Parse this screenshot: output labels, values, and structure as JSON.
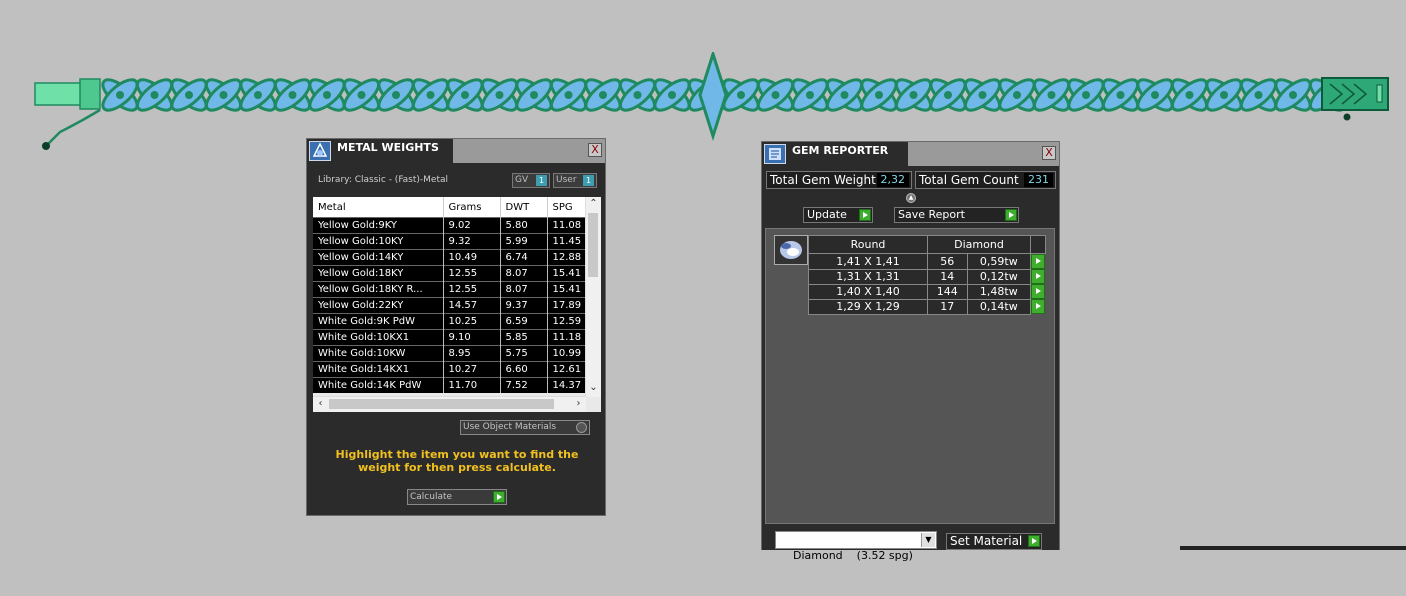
{
  "colors": {
    "viewport_bg": "#c0c0c0",
    "panel_bg": "#2b2b2b",
    "hint_text": "#f0c020",
    "go_green": "#3fae2f",
    "gem_teal": "#1f8a60",
    "gem_blue": "#6fb8e8"
  },
  "metal_weights": {
    "title": "METAL WEIGHTS",
    "close_label": "X",
    "library": "Library: Classic - (Fast)-Metal",
    "toggle_gv": "GV",
    "toggle_user": "User",
    "toggle_value": "1",
    "columns": [
      "Metal",
      "Grams",
      "DWT",
      "SPG"
    ],
    "rows": [
      [
        "Yellow Gold:9KY",
        "9.02",
        "5.80",
        "11.08"
      ],
      [
        "Yellow Gold:10KY",
        "9.32",
        "5.99",
        "11.45"
      ],
      [
        "Yellow Gold:14KY",
        "10.49",
        "6.74",
        "12.88"
      ],
      [
        "Yellow Gold:18KY",
        "12.55",
        "8.07",
        "15.41"
      ],
      [
        "Yellow Gold:18KY R...",
        "12.55",
        "8.07",
        "15.41"
      ],
      [
        "Yellow Gold:22KY",
        "14.57",
        "9.37",
        "17.89"
      ],
      [
        "White Gold:9K PdW",
        "10.25",
        "6.59",
        "12.59"
      ],
      [
        "White Gold:10KX1",
        "9.10",
        "5.85",
        "11.18"
      ],
      [
        "White Gold:10KW",
        "8.95",
        "5.75",
        "10.99"
      ],
      [
        "White Gold:14KX1",
        "10.27",
        "6.60",
        "12.61"
      ],
      [
        "White Gold:14K PdW",
        "11.70",
        "7.52",
        "14.37"
      ]
    ],
    "use_object_materials": "Use Object Materials",
    "hint": "Highlight the item you want to find the weight for then press calculate.",
    "calculate_label": "Calculate"
  },
  "gem_reporter": {
    "title": "GEM REPORTER",
    "close_label": "X",
    "total_weight_label": "Total Gem Weight",
    "total_weight_value": "2,32",
    "total_count_label": "Total Gem Count",
    "total_count_value": "231",
    "update_label": "Update",
    "save_report_label": "Save Report",
    "table_headers": [
      "Round",
      "Diamond"
    ],
    "rows": [
      {
        "size": "1,41 X 1,41",
        "count": "56",
        "weight": "0,59tw"
      },
      {
        "size": "1,31 X 1,31",
        "count": "14",
        "weight": "0,12tw"
      },
      {
        "size": "1,40 X 1,40",
        "count": "144",
        "weight": "1,48tw"
      },
      {
        "size": "1,29 X 1,29",
        "count": "17",
        "weight": "0,14tw"
      }
    ],
    "material_select": "Diamond    (3.52 spg)",
    "set_material_label": "Set Material"
  }
}
